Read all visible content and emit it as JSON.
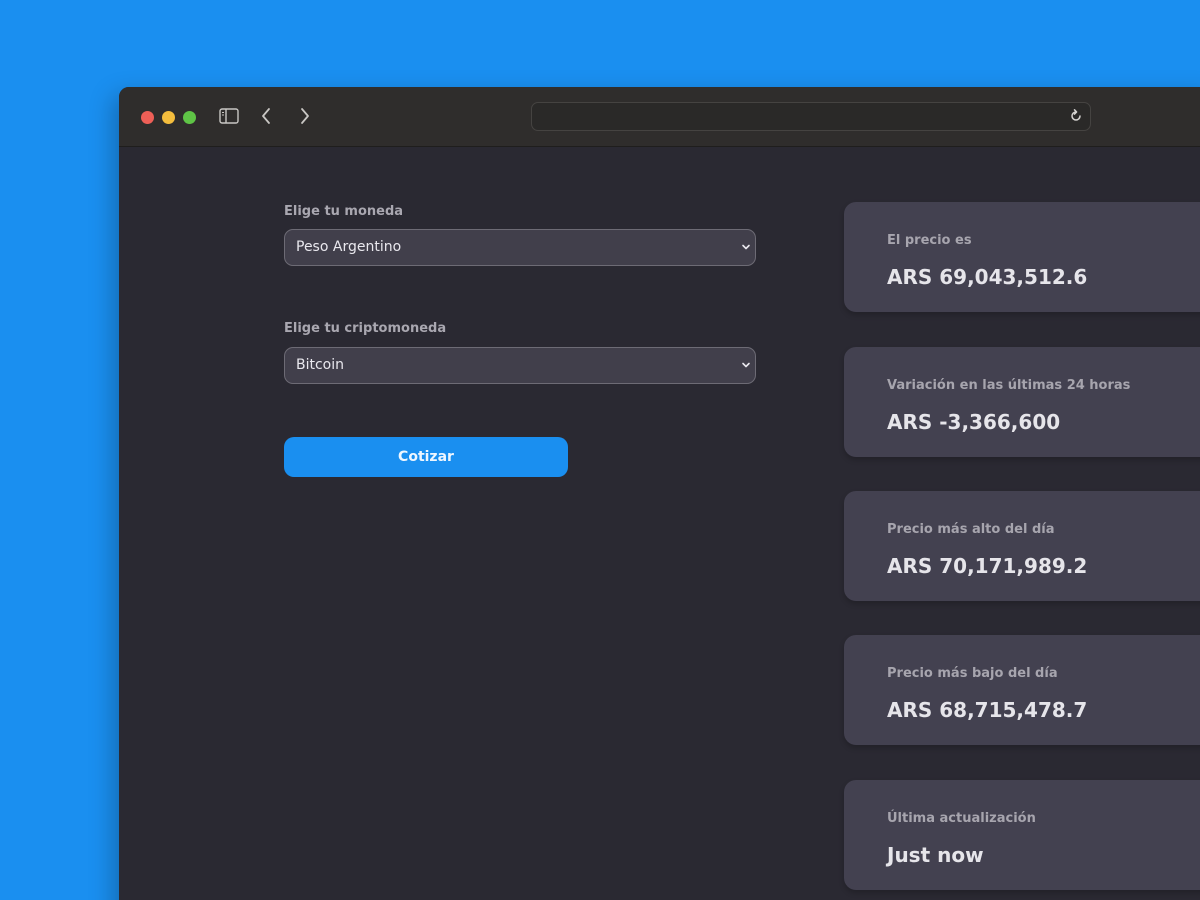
{
  "browser": {
    "address_value": "",
    "icons": {
      "sidebar": "sidebar-icon",
      "back": "chevron-left-icon",
      "forward": "chevron-right-icon",
      "reload": "reload-icon"
    }
  },
  "form": {
    "currency": {
      "label": "Elige tu moneda",
      "selected": "Peso Argentino"
    },
    "crypto": {
      "label": "Elige tu criptomoneda",
      "selected": "Bitcoin"
    },
    "submit_label": "Cotizar"
  },
  "results": [
    {
      "label": "El precio es",
      "value": "ARS 69,043,512.6"
    },
    {
      "label": "Variación en las últimas 24 horas",
      "value": "ARS -3,366,600"
    },
    {
      "label": "Precio más alto del día",
      "value": "ARS 70,171,989.2"
    },
    {
      "label": "Precio más bajo del día",
      "value": "ARS 68,715,478.7"
    },
    {
      "label": "Última actualización",
      "value": "Just now"
    }
  ],
  "colors": {
    "accent": "#1a8ff0",
    "page_bg": "#2a2932",
    "card_bg": "#434150",
    "select_bg": "#413f4b"
  }
}
